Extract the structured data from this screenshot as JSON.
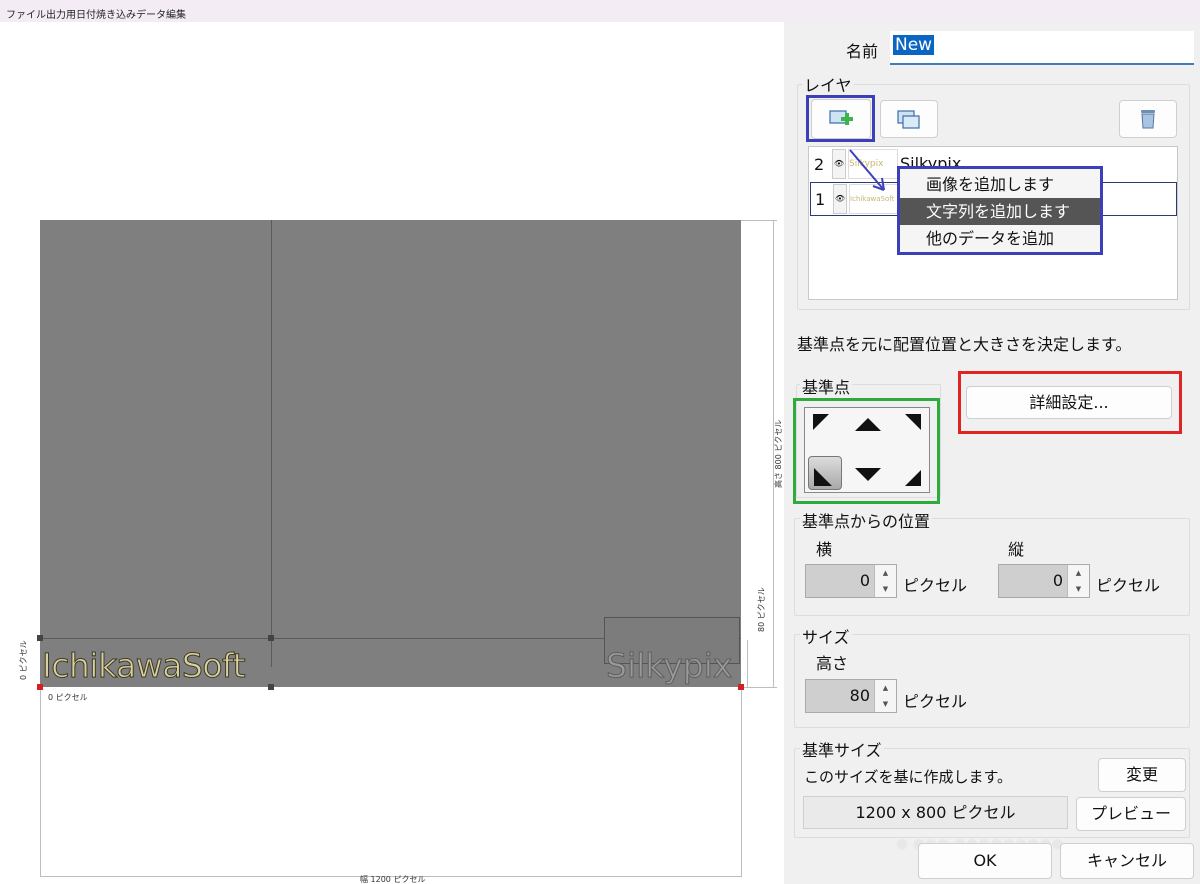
{
  "window": {
    "title": "ファイル出力用日付焼き込みデータ編集"
  },
  "canvas": {
    "layer_text_1": "IchikawaSoft",
    "layer_text_2": "Silkypix",
    "dim_height": "高さ 800 ピクセル",
    "dim_width": "幅 1200 ピクセル",
    "dim_80": "80 ピクセル",
    "dim_left_0": "0 ピクセル",
    "dim_bottom_0": "0 ピクセル"
  },
  "panel": {
    "name_label": "名前",
    "name_value": "New",
    "layer_group": "レイヤ",
    "layers": [
      {
        "index": "2",
        "eye": "👁",
        "thumb": "Silkypix",
        "name": "Silkypix"
      },
      {
        "index": "1",
        "eye": "👁",
        "thumb": "IchikawaSoft",
        "name": ""
      }
    ],
    "menu_items": [
      "画像を追加します",
      "文字列を追加します",
      "他のデータを追加"
    ],
    "anchor_desc": "基準点を元に配置位置と大きさを決定します。",
    "anchor_group": "基準点",
    "detail_button": "詳細設定...",
    "position_group": "基準点からの位置",
    "horizontal_label": "横",
    "vertical_label": "縦",
    "horizontal_value": "0",
    "vertical_value": "0",
    "pixel_unit": "ピクセル",
    "size_group": "サイズ",
    "height_label": "高さ",
    "height_value": "80",
    "base_size_group": "基準サイズ",
    "base_size_desc": "このサイズを基に作成します。",
    "base_size_value": "1200 x 800 ピクセル",
    "change_button": "変更",
    "preview_button": "プレビュー",
    "ok_button": "OK",
    "cancel_button": "キャンセル"
  },
  "colors": {
    "highlight_blue": "#3c40b8",
    "highlight_green": "#2faa3e",
    "highlight_red": "#e02424",
    "selection": "#0a66c2"
  }
}
